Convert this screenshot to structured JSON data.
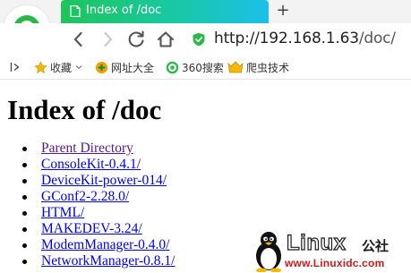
{
  "tab": {
    "title": "Index of /doc",
    "new_tab_symbol": "+"
  },
  "address_bar": {
    "host": "http://192.168.1.63",
    "path": "/doc/"
  },
  "bookmarks": [
    {
      "label": "收藏",
      "icon": "star-icon"
    },
    {
      "label": "网址大全",
      "icon": "plus-circle-icon"
    },
    {
      "label": "360搜索",
      "icon": "360-search-icon"
    },
    {
      "label": "爬虫技术",
      "icon": "folder-crown-icon"
    }
  ],
  "page": {
    "title": "Index of /doc",
    "entries": [
      "Parent Directory",
      "ConsoleKit-0.4.1/",
      "DeviceKit-power-014/",
      "GConf2-2.28.0/",
      "HTML/",
      "MAKEDEV-3.24/",
      "ModemManager-0.4.0/",
      "NetworkManager-0.8.1/"
    ]
  },
  "watermark": {
    "brand": "Linux",
    "brand_cn": "公社",
    "url": "www.Linuxidc.com"
  },
  "colors": {
    "tab_start": "#1fc45a",
    "tab_end": "#1cc0e8",
    "link": "#0000ee",
    "visited_link": "#551a8b",
    "logo_green": "#2bb84a"
  }
}
